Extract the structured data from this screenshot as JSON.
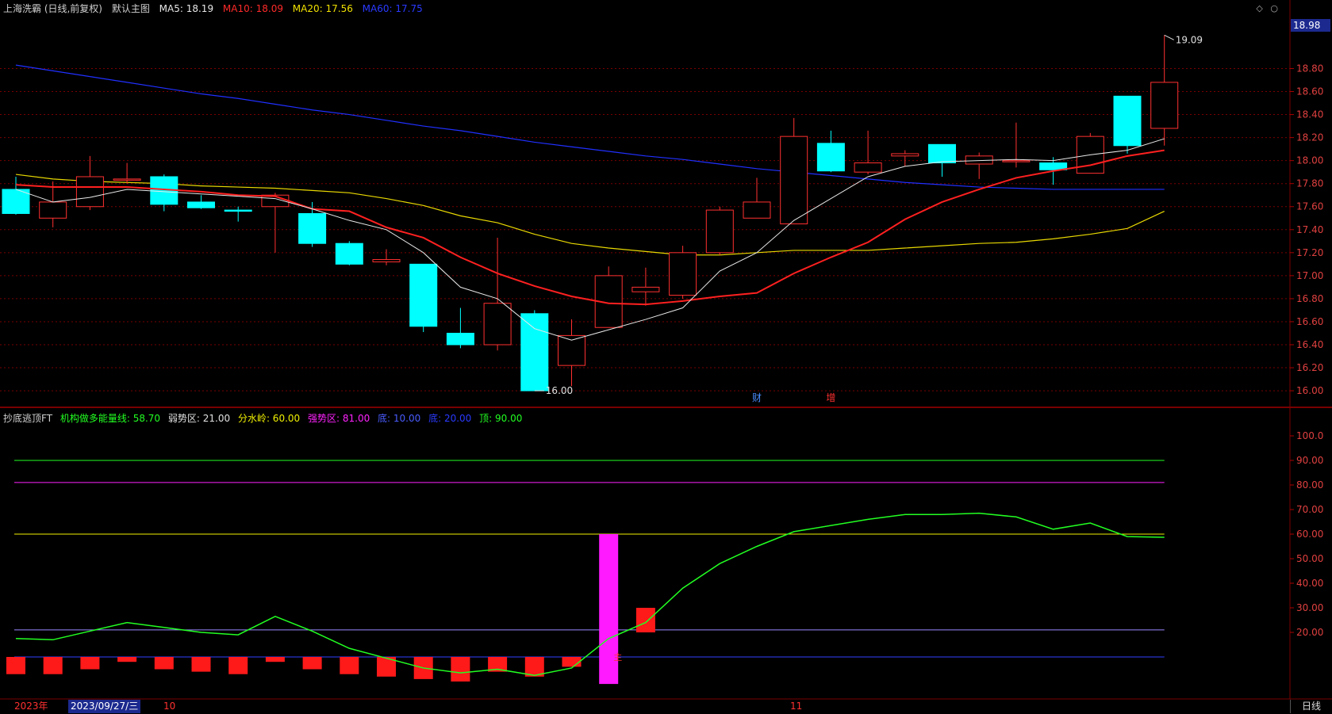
{
  "header": {
    "title": "上海洗霸 (日线,前复权)",
    "main_chart_label": "默认主图",
    "ma": [
      {
        "label": "MA5: 18.19",
        "color": "#e8e8e8"
      },
      {
        "label": "MA10: 18.09",
        "color": "#ff2a2a"
      },
      {
        "label": "MA20: 17.56",
        "color": "#f0e000"
      },
      {
        "label": "MA60: 17.75",
        "color": "#2a3aff"
      }
    ]
  },
  "price_tag": "18.98",
  "price_axis": [
    "18.80",
    "18.60",
    "18.40",
    "18.20",
    "18.00",
    "17.80",
    "17.60",
    "17.40",
    "17.20",
    "17.00",
    "16.80",
    "16.60",
    "16.40",
    "16.20",
    "16.00"
  ],
  "high_marker": "19.09",
  "low_marker": "16.00",
  "event_markers": [
    {
      "label": "财",
      "color": "#4a8cff"
    },
    {
      "label": "增",
      "color": "#ff3030"
    }
  ],
  "indicator": {
    "name": "抄底逃顶FT",
    "items": [
      {
        "label": "机构做多能量线: 58.70",
        "color": "#22ff22"
      },
      {
        "label": "弱势区: 21.00",
        "color": "#e0e0e0"
      },
      {
        "label": "分水岭: 60.00",
        "color": "#f0f000"
      },
      {
        "label": "强势区: 81.00",
        "color": "#ff22ff"
      },
      {
        "label": "底: 10.00",
        "color": "#4a5cff"
      },
      {
        "label": "底: 20.00",
        "color": "#2a3aff"
      },
      {
        "label": "顶: 90.00",
        "color": "#22ff22"
      }
    ],
    "axis": [
      "100.0",
      "90.00",
      "80.00",
      "70.00",
      "60.00",
      "50.00",
      "40.00",
      "30.00",
      "20.00"
    ],
    "bar_label": "主"
  },
  "colors": {
    "up": "#ff3030",
    "down": "#00ffff",
    "ma5": "#e8e8e8",
    "ma10": "#ff2020",
    "ma20": "#e8d800",
    "ma60": "#2030ff",
    "grid": "#7a0000",
    "energy": "#22ff22"
  },
  "chart_data": [
    {
      "type": "candlestick",
      "title": "上海洗霸 (日线,前复权)",
      "ylim": [
        15.98,
        19.12
      ],
      "candles": [
        {
          "o": 17.75,
          "h": 17.86,
          "l": 17.53,
          "c": 17.54
        },
        {
          "o": 17.5,
          "h": 17.82,
          "l": 17.42,
          "c": 17.64
        },
        {
          "o": 17.6,
          "h": 18.04,
          "l": 17.57,
          "c": 17.86
        },
        {
          "o": 17.84,
          "h": 17.98,
          "l": 17.8,
          "c": 17.84
        },
        {
          "o": 17.86,
          "h": 17.88,
          "l": 17.56,
          "c": 17.62
        },
        {
          "o": 17.64,
          "h": 17.7,
          "l": 17.58,
          "c": 17.59
        },
        {
          "o": 17.57,
          "h": 17.6,
          "l": 17.47,
          "c": 17.56
        },
        {
          "o": 17.6,
          "h": 17.72,
          "l": 17.2,
          "c": 17.7
        },
        {
          "o": 17.54,
          "h": 17.64,
          "l": 17.25,
          "c": 17.28
        },
        {
          "o": 17.28,
          "h": 17.3,
          "l": 17.09,
          "c": 17.1
        },
        {
          "o": 17.12,
          "h": 17.23,
          "l": 17.09,
          "c": 17.14
        },
        {
          "o": 17.1,
          "h": 17.1,
          "l": 16.51,
          "c": 16.56
        },
        {
          "o": 16.5,
          "h": 16.72,
          "l": 16.37,
          "c": 16.4
        },
        {
          "o": 16.4,
          "h": 17.33,
          "l": 16.35,
          "c": 16.76
        },
        {
          "o": 16.67,
          "h": 16.7,
          "l": 16.0,
          "c": 16.0
        },
        {
          "o": 16.22,
          "h": 16.62,
          "l": 16.04,
          "c": 16.48
        },
        {
          "o": 16.55,
          "h": 17.08,
          "l": 16.55,
          "c": 17.0
        },
        {
          "o": 16.86,
          "h": 17.07,
          "l": 16.74,
          "c": 16.9
        },
        {
          "o": 16.83,
          "h": 17.26,
          "l": 16.8,
          "c": 17.2
        },
        {
          "o": 17.2,
          "h": 17.6,
          "l": 17.18,
          "c": 17.57
        },
        {
          "o": 17.5,
          "h": 17.85,
          "l": 17.5,
          "c": 17.64
        },
        {
          "o": 17.45,
          "h": 18.37,
          "l": 17.45,
          "c": 18.21
        },
        {
          "o": 18.15,
          "h": 18.26,
          "l": 17.9,
          "c": 17.91
        },
        {
          "o": 17.9,
          "h": 18.26,
          "l": 17.88,
          "c": 17.98
        },
        {
          "o": 18.04,
          "h": 18.09,
          "l": 17.95,
          "c": 18.06
        },
        {
          "o": 18.14,
          "h": 18.14,
          "l": 17.86,
          "c": 17.98
        },
        {
          "o": 17.97,
          "h": 18.07,
          "l": 17.84,
          "c": 18.04
        },
        {
          "o": 18.0,
          "h": 18.33,
          "l": 17.94,
          "c": 18.0
        },
        {
          "o": 17.98,
          "h": 18.03,
          "l": 17.79,
          "c": 17.92
        },
        {
          "o": 17.89,
          "h": 18.24,
          "l": 17.89,
          "c": 18.21
        },
        {
          "o": 18.56,
          "h": 18.56,
          "l": 18.06,
          "c": 18.13
        },
        {
          "o": 18.28,
          "h": 19.09,
          "l": 18.13,
          "c": 18.68
        }
      ],
      "ma5": [
        17.75,
        17.64,
        17.68,
        17.75,
        17.73,
        17.71,
        17.69,
        17.67,
        17.58,
        17.48,
        17.4,
        17.2,
        16.9,
        16.8,
        16.54,
        16.44,
        16.53,
        16.62,
        16.72,
        17.04,
        17.2,
        17.48,
        17.67,
        17.86,
        17.95,
        17.99,
        18.0,
        18.01,
        18.0,
        18.05,
        18.09,
        18.19
      ],
      "ma10": [
        17.79,
        17.77,
        17.77,
        17.77,
        17.75,
        17.73,
        17.7,
        17.69,
        17.58,
        17.56,
        17.42,
        17.33,
        17.16,
        17.02,
        16.91,
        16.82,
        16.76,
        16.75,
        16.78,
        16.82,
        16.85,
        17.02,
        17.16,
        17.29,
        17.49,
        17.64,
        17.75,
        17.85,
        17.91,
        17.96,
        18.04,
        18.09
      ],
      "ma20": [
        17.88,
        17.84,
        17.82,
        17.81,
        17.8,
        17.78,
        17.77,
        17.76,
        17.74,
        17.72,
        17.67,
        17.61,
        17.52,
        17.46,
        17.36,
        17.28,
        17.24,
        17.21,
        17.18,
        17.18,
        17.2,
        17.22,
        17.22,
        17.22,
        17.24,
        17.26,
        17.28,
        17.29,
        17.32,
        17.36,
        17.41,
        17.56
      ],
      "ma60": [
        18.83,
        18.78,
        18.73,
        18.68,
        18.63,
        18.58,
        18.54,
        18.49,
        18.44,
        18.4,
        18.35,
        18.3,
        18.26,
        18.21,
        18.16,
        18.12,
        18.08,
        18.04,
        18.01,
        17.97,
        17.93,
        17.9,
        17.87,
        17.84,
        17.81,
        17.79,
        17.77,
        17.76,
        17.75,
        17.75,
        17.75,
        17.75
      ]
    },
    {
      "type": "line",
      "title": "抄底逃顶FT",
      "ylim": [
        0,
        100
      ],
      "energy": [
        17.5,
        17.0,
        20.5,
        24.0,
        22.0,
        20.0,
        19.0,
        26.5,
        20.5,
        13.5,
        9.5,
        5.5,
        3.5,
        5.0,
        2.5,
        5.5,
        17.5,
        24.0,
        38.0,
        48.0,
        55.0,
        61.0,
        63.5,
        66.0,
        68.0,
        68.0,
        68.5,
        67.0,
        62.0,
        64.5,
        59.0,
        58.7
      ],
      "levels": [
        {
          "name": "顶",
          "value": 90,
          "color": "#22ff22"
        },
        {
          "name": "强势区",
          "value": 81,
          "color": "#ff22ff"
        },
        {
          "name": "分水岭",
          "value": 60,
          "color": "#f0f000"
        },
        {
          "name": "弱势区",
          "value": 21,
          "color": "#9a8aff"
        },
        {
          "name": "底",
          "value": 10,
          "color": "#3040ff"
        }
      ],
      "red_bars": [
        [
          3,
          10
        ],
        [
          3,
          10
        ],
        [
          5,
          10
        ],
        [
          8,
          10
        ],
        [
          5,
          10
        ],
        [
          4,
          10
        ],
        [
          3,
          10
        ],
        [
          8,
          10
        ],
        [
          5,
          10
        ],
        [
          3,
          10
        ],
        [
          2,
          10
        ],
        [
          1,
          10
        ],
        [
          0,
          10
        ],
        [
          4,
          10
        ],
        [
          2,
          10
        ],
        [
          6,
          10
        ],
        null,
        [
          20,
          30
        ]
      ],
      "magenta_bar": {
        "index": 16,
        "from": -1,
        "to": 60
      }
    }
  ],
  "bottom_axis": {
    "year": "2023年",
    "cursor_date": "2023/09/27/三",
    "month_oct": "10",
    "month_nov": "11"
  },
  "period_button": "日线",
  "corner_icons": [
    "diamond-icon",
    "circle-icon"
  ]
}
